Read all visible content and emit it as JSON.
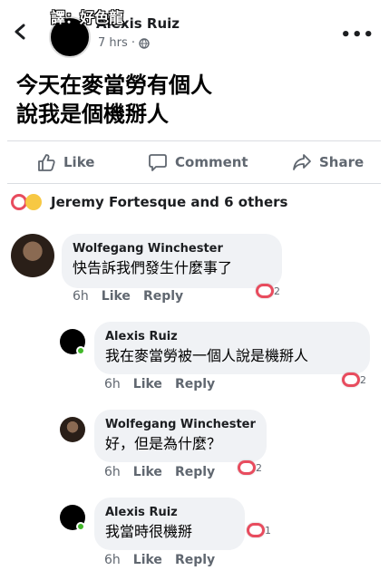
{
  "watermark": "譯：好色龍",
  "post": {
    "author": "Alexis Ruiz",
    "time": "7 hrs ·",
    "text_line1": "今天在麥當勞有個人",
    "text_line2": "說我是個機掰人"
  },
  "actions": {
    "like": "Like",
    "comment": "Comment",
    "share": "Share"
  },
  "reactions": {
    "summary": "Jeremy Fortesque and 6 others"
  },
  "comments": [
    {
      "name": "Wolfegang Winchester",
      "text": "快告訴我們發生什麼事了",
      "time": "6h",
      "like": "Like",
      "reply": "Reply",
      "likes": "2"
    },
    {
      "name": "Alexis Ruiz",
      "text": "我在麥當勞被一個人說是機掰人",
      "time": "6h",
      "like": "Like",
      "reply": "Reply",
      "likes": "2"
    },
    {
      "name": "Wolfegang Winchester",
      "text": "好，但是為什麼？",
      "time": "6h",
      "like": "Like",
      "reply": "Reply",
      "likes": "2"
    },
    {
      "name": "Alexis Ruiz",
      "text": "我當時很機掰",
      "time": "6h",
      "like": "Like",
      "reply": "Reply",
      "likes": "1"
    }
  ],
  "colors": {
    "accent_love": "#e84c5e",
    "online": "#42b72a",
    "bubble": "#f0f2f5"
  }
}
